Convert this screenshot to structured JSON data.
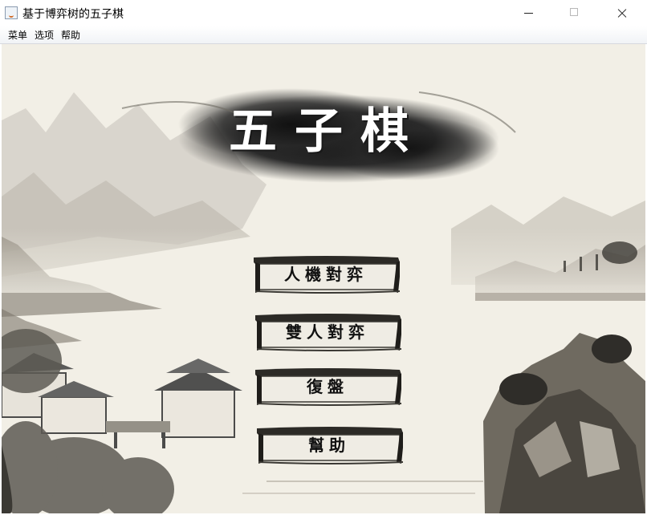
{
  "window": {
    "title": "基于博弈树的五子棋"
  },
  "menubar": {
    "items": [
      {
        "label": "菜单"
      },
      {
        "label": "选项"
      },
      {
        "label": "帮助"
      }
    ]
  },
  "game": {
    "title": "五子棋"
  },
  "main_menu": {
    "buttons": [
      {
        "label": "人機對弈"
      },
      {
        "label": "雙人對弈"
      },
      {
        "label": "復盤"
      },
      {
        "label": "幫助"
      }
    ]
  }
}
